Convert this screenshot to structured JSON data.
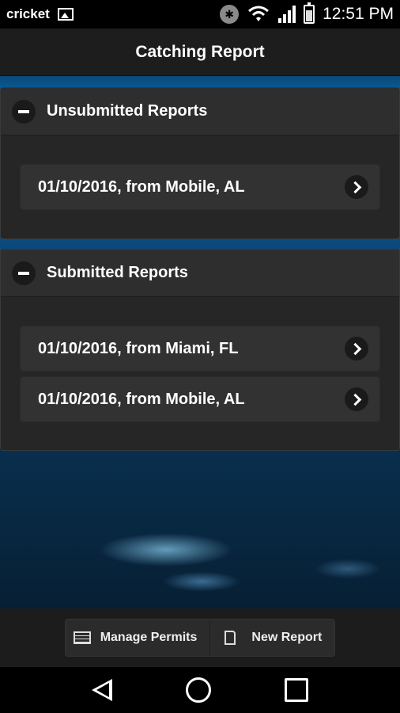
{
  "status_bar": {
    "carrier": "cricket",
    "time": "12:51 PM",
    "icons": [
      "image-icon",
      "bluetooth-icon",
      "wifi-icon",
      "signal-icon",
      "battery-icon"
    ]
  },
  "header": {
    "title": "Catching Report"
  },
  "sections": [
    {
      "title": "Unsubmitted Reports",
      "items": [
        {
          "label": "01/10/2016, from Mobile, AL"
        }
      ]
    },
    {
      "title": "Submitted Reports",
      "items": [
        {
          "label": "01/10/2016, from Miami, FL"
        },
        {
          "label": "01/10/2016, from Mobile, AL"
        }
      ]
    }
  ],
  "toolbar": {
    "manage_permits_label": "Manage Permits",
    "new_report_label": "New Report"
  },
  "colors": {
    "header_bg": "#1d1d1d",
    "panel_bg": "#262626",
    "accent_blue": "#0b6fb4"
  }
}
